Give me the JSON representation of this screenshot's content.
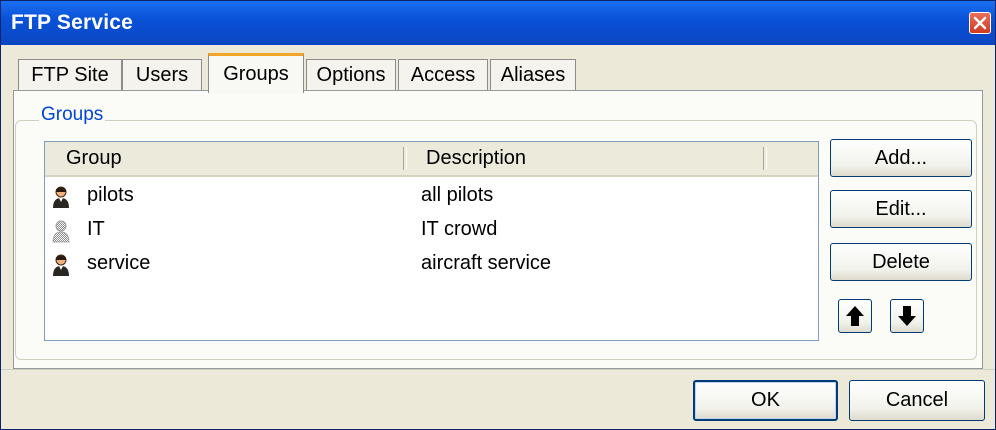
{
  "window": {
    "title": "FTP Service"
  },
  "tabs": [
    {
      "label": "FTP Site",
      "active": false
    },
    {
      "label": "Users",
      "active": false
    },
    {
      "label": "Groups",
      "active": true
    },
    {
      "label": "Options",
      "active": false
    },
    {
      "label": "Access",
      "active": false
    },
    {
      "label": "Aliases",
      "active": false
    }
  ],
  "groups_box": {
    "label": "Groups",
    "columns": [
      "Group",
      "Description"
    ],
    "rows": [
      {
        "icon": "user-group-icon",
        "group": "pilots",
        "description": "all pilots"
      },
      {
        "icon": "user-group-disabled-icon",
        "group": "IT",
        "description": "IT crowd"
      },
      {
        "icon": "user-group-icon",
        "group": "service",
        "description": "aircraft service"
      }
    ],
    "buttons": {
      "add": "Add...",
      "edit": "Edit...",
      "delete": "Delete"
    },
    "move_up_icon": "arrow-up-icon",
    "move_down_icon": "arrow-down-icon"
  },
  "footer": {
    "ok": "OK",
    "cancel": "Cancel"
  },
  "colors": {
    "titlebar": "#0a52d8",
    "accent_tab": "#f3a529",
    "groupbox_label": "#0046d5",
    "face": "#ece9d8"
  }
}
